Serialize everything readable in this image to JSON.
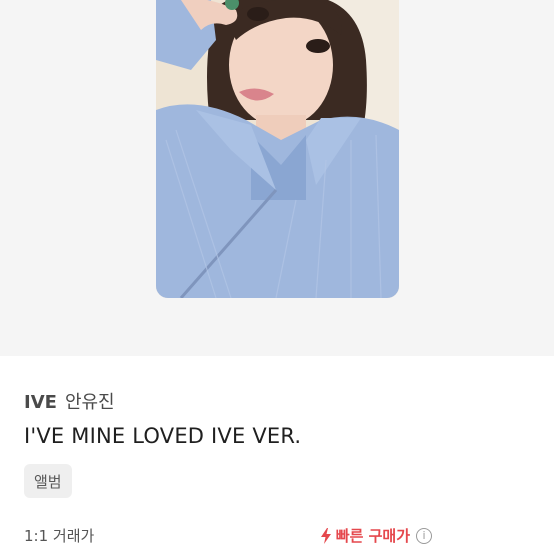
{
  "product": {
    "artist": "IVE",
    "member": "안유진",
    "title": "I'VE MINE LOVED IVE VER.",
    "tag": "앨범"
  },
  "pricing": {
    "label": "1:1 거래가",
    "fast_buy_label": "빠른 구매가",
    "info_glyph": "i"
  },
  "colors": {
    "hero_background": "#f5f5f5",
    "fast_buy_accent": "#e5484d",
    "tag_background": "#efefef"
  }
}
